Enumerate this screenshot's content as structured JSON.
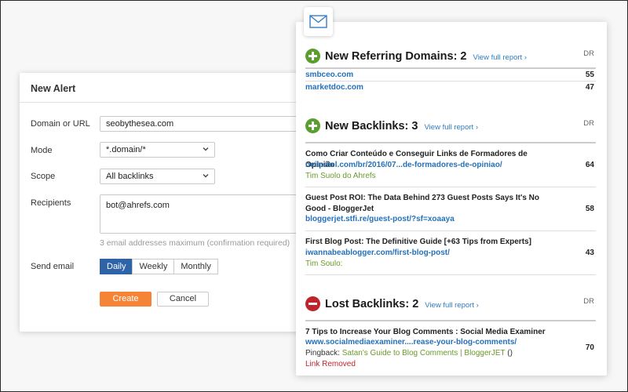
{
  "alert_form": {
    "title": "New Alert",
    "domain_label": "Domain or URL",
    "domain_value": "seobythesea.com",
    "mode_label": "Mode",
    "mode_value": "*.domain/*",
    "scope_label": "Scope",
    "scope_value": "All backlinks",
    "recipients_label": "Recipients",
    "recipients_value": "bot@ahrefs.com",
    "recipients_hint": "3 email addresses maximum (confirmation required)",
    "send_email_label": "Send email",
    "frequency_options": [
      "Daily",
      "Weekly",
      "Monthly"
    ],
    "frequency_selected": "Daily",
    "create_label": "Create",
    "cancel_label": "Cancel"
  },
  "email_report": {
    "icon": "envelope-icon",
    "dr_label": "DR",
    "view_full_report": "View full report ›",
    "referring_domains": {
      "title": "New Referring Domains: 2",
      "icon": "plus-circle-icon",
      "rows": [
        {
          "domain": "smbceo.com",
          "dr": "55"
        },
        {
          "domain": "marketdoc.com",
          "dr": "47"
        }
      ]
    },
    "new_backlinks": {
      "title": "New Backlinks: 3",
      "icon": "plus-circle-icon",
      "rows": [
        {
          "title": "Como Criar Conteúdo e Conseguir Links de Formadores de Opinião",
          "url": "neilpatel.com/br/2016/07...de-formadores-de-opiniao/",
          "author": "Tim Suolo do Ahrefs",
          "dr": "64"
        },
        {
          "title": "Guest Post ROI: The Data Behind 273 Guest Posts Says It's No Good - BloggerJet",
          "url": "bloggerjet.stfi.re/guest-post/?sf=xoaaya",
          "author": "",
          "dr": "58"
        },
        {
          "title": "First Blog Post: The Definitive Guide [+63 Tips from Experts]",
          "url": "iwannabeablogger.com/first-blog-post/",
          "author": "Tim Soulo:",
          "dr": "43"
        }
      ]
    },
    "lost_backlinks": {
      "title": "Lost Backlinks: 2",
      "icon": "minus-circle-icon",
      "rows": [
        {
          "title": "7 Tips to Increase Your Blog Comments : Social Media Examiner",
          "url": "www.socialmediaexaminer....rease-your-blog-comments/",
          "pingback_label": "Pingback:",
          "pingback_link": "Satan's Guide to Blog Comments | BloggerJET",
          "pingback_suffix": " ()",
          "status": "Link Removed",
          "dr": "70"
        }
      ]
    }
  },
  "colors": {
    "accent_blue": "#2f63a8",
    "create_orange": "#f58436",
    "link_blue": "#2471ba",
    "add_green": "#5a9e2f",
    "lost_red": "#c0242b"
  }
}
